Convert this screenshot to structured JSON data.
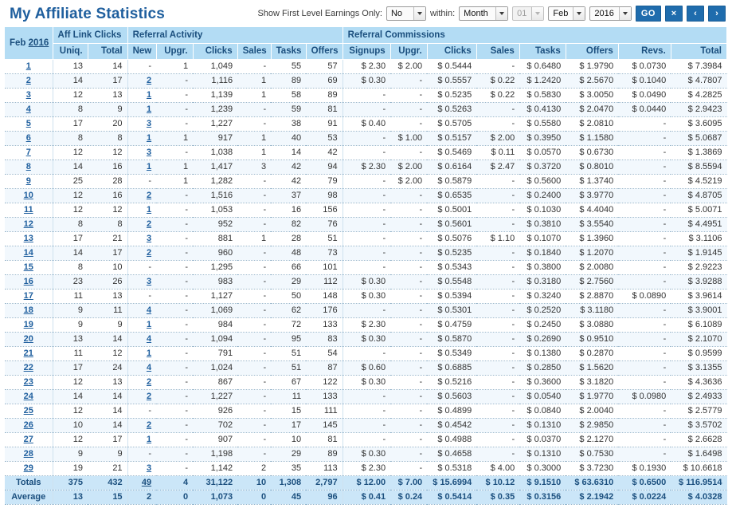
{
  "header": {
    "title": "My Affiliate Statistics",
    "controls": {
      "first_level_label": "Show First Level Earnings Only:",
      "first_level_value": "No",
      "within_label": "within:",
      "within_value": "Month",
      "day_value": "01",
      "month_value": "Feb",
      "year_value": "2016",
      "go_label": "GO",
      "clear_label": "×",
      "prev_label": "‹",
      "next_label": "›"
    }
  },
  "table": {
    "date_label_month": "Feb",
    "date_label_year": "2016",
    "groups": [
      {
        "label": "Aff Link Clicks",
        "span": 2
      },
      {
        "label": "Referral Activity",
        "span": 6
      },
      {
        "label": "Referral Commissions",
        "span": 8
      }
    ],
    "columns": [
      "Uniq.",
      "Total",
      "New",
      "Upgr.",
      "Clicks",
      "Sales",
      "Tasks",
      "Offers",
      "Signups",
      "Upgr.",
      "Clicks",
      "Sales",
      "Tasks",
      "Offers",
      "Revs.",
      "Total"
    ],
    "totals_label": "Totals",
    "average_label": "Average",
    "rows": [
      {
        "day": "1",
        "cells": [
          "13",
          "14",
          "-",
          "1",
          "1,049",
          "-",
          "55",
          "57",
          "$ 2.30",
          "$ 2.00",
          "$ 0.5444",
          "-",
          "$ 0.6480",
          "$ 1.9790",
          "$ 0.0730",
          "$ 7.3984"
        ],
        "links": []
      },
      {
        "day": "2",
        "cells": [
          "14",
          "17",
          "2",
          "-",
          "1,116",
          "1",
          "89",
          "69",
          "$ 0.30",
          "-",
          "$ 0.5557",
          "$ 0.22",
          "$ 1.2420",
          "$ 2.5670",
          "$ 0.1040",
          "$ 4.7807"
        ],
        "links": [
          2
        ]
      },
      {
        "day": "3",
        "cells": [
          "12",
          "13",
          "1",
          "-",
          "1,139",
          "1",
          "58",
          "89",
          "-",
          "-",
          "$ 0.5235",
          "$ 0.22",
          "$ 0.5830",
          "$ 3.0050",
          "$ 0.0490",
          "$ 4.2825"
        ],
        "links": [
          2
        ]
      },
      {
        "day": "4",
        "cells": [
          "8",
          "9",
          "1",
          "-",
          "1,239",
          "-",
          "59",
          "81",
          "-",
          "-",
          "$ 0.5263",
          "-",
          "$ 0.4130",
          "$ 2.0470",
          "$ 0.0440",
          "$ 2.9423"
        ],
        "links": [
          2
        ]
      },
      {
        "day": "5",
        "cells": [
          "17",
          "20",
          "3",
          "-",
          "1,227",
          "-",
          "38",
          "91",
          "$ 0.40",
          "-",
          "$ 0.5705",
          "-",
          "$ 0.5580",
          "$ 2.0810",
          "-",
          "$ 3.6095"
        ],
        "links": [
          2
        ]
      },
      {
        "day": "6",
        "cells": [
          "8",
          "8",
          "1",
          "1",
          "917",
          "1",
          "40",
          "53",
          "-",
          "$ 1.00",
          "$ 0.5157",
          "$ 2.00",
          "$ 0.3950",
          "$ 1.1580",
          "-",
          "$ 5.0687"
        ],
        "links": [
          2
        ]
      },
      {
        "day": "7",
        "cells": [
          "12",
          "12",
          "3",
          "-",
          "1,038",
          "1",
          "14",
          "42",
          "-",
          "-",
          "$ 0.5469",
          "$ 0.11",
          "$ 0.0570",
          "$ 0.6730",
          "-",
          "$ 1.3869"
        ],
        "links": [
          2
        ]
      },
      {
        "day": "8",
        "cells": [
          "14",
          "16",
          "1",
          "1",
          "1,417",
          "3",
          "42",
          "94",
          "$ 2.30",
          "$ 2.00",
          "$ 0.6164",
          "$ 2.47",
          "$ 0.3720",
          "$ 0.8010",
          "-",
          "$ 8.5594"
        ],
        "links": [
          2
        ]
      },
      {
        "day": "9",
        "cells": [
          "25",
          "28",
          "-",
          "1",
          "1,282",
          "-",
          "42",
          "79",
          "-",
          "$ 2.00",
          "$ 0.5879",
          "-",
          "$ 0.5600",
          "$ 1.3740",
          "-",
          "$ 4.5219"
        ],
        "links": []
      },
      {
        "day": "10",
        "cells": [
          "12",
          "16",
          "2",
          "-",
          "1,516",
          "-",
          "37",
          "98",
          "-",
          "-",
          "$ 0.6535",
          "-",
          "$ 0.2400",
          "$ 3.9770",
          "-",
          "$ 4.8705"
        ],
        "links": [
          2
        ]
      },
      {
        "day": "11",
        "cells": [
          "12",
          "12",
          "1",
          "-",
          "1,053",
          "-",
          "16",
          "156",
          "-",
          "-",
          "$ 0.5001",
          "-",
          "$ 0.1030",
          "$ 4.4040",
          "-",
          "$ 5.0071"
        ],
        "links": [
          2
        ]
      },
      {
        "day": "12",
        "cells": [
          "8",
          "8",
          "2",
          "-",
          "952",
          "-",
          "82",
          "76",
          "-",
          "-",
          "$ 0.5601",
          "-",
          "$ 0.3810",
          "$ 3.5540",
          "-",
          "$ 4.4951"
        ],
        "links": [
          2
        ]
      },
      {
        "day": "13",
        "cells": [
          "17",
          "21",
          "3",
          "-",
          "881",
          "1",
          "28",
          "51",
          "-",
          "-",
          "$ 0.5076",
          "$ 1.10",
          "$ 0.1070",
          "$ 1.3960",
          "-",
          "$ 3.1106"
        ],
        "links": [
          2
        ]
      },
      {
        "day": "14",
        "cells": [
          "14",
          "17",
          "2",
          "-",
          "960",
          "-",
          "48",
          "73",
          "-",
          "-",
          "$ 0.5235",
          "-",
          "$ 0.1840",
          "$ 1.2070",
          "-",
          "$ 1.9145"
        ],
        "links": [
          2
        ]
      },
      {
        "day": "15",
        "cells": [
          "8",
          "10",
          "-",
          "-",
          "1,295",
          "-",
          "66",
          "101",
          "-",
          "-",
          "$ 0.5343",
          "-",
          "$ 0.3800",
          "$ 2.0080",
          "-",
          "$ 2.9223"
        ],
        "links": []
      },
      {
        "day": "16",
        "cells": [
          "23",
          "26",
          "3",
          "-",
          "983",
          "-",
          "29",
          "112",
          "$ 0.30",
          "-",
          "$ 0.5548",
          "-",
          "$ 0.3180",
          "$ 2.7560",
          "-",
          "$ 3.9288"
        ],
        "links": [
          2
        ]
      },
      {
        "day": "17",
        "cells": [
          "11",
          "13",
          "-",
          "-",
          "1,127",
          "-",
          "50",
          "148",
          "$ 0.30",
          "-",
          "$ 0.5394",
          "-",
          "$ 0.3240",
          "$ 2.8870",
          "$ 0.0890",
          "$ 3.9614"
        ],
        "links": []
      },
      {
        "day": "18",
        "cells": [
          "9",
          "11",
          "4",
          "-",
          "1,069",
          "-",
          "62",
          "176",
          "-",
          "-",
          "$ 0.5301",
          "-",
          "$ 0.2520",
          "$ 3.1180",
          "-",
          "$ 3.9001"
        ],
        "links": [
          2
        ]
      },
      {
        "day": "19",
        "cells": [
          "9",
          "9",
          "1",
          "-",
          "984",
          "-",
          "72",
          "133",
          "$ 2.30",
          "-",
          "$ 0.4759",
          "-",
          "$ 0.2450",
          "$ 3.0880",
          "-",
          "$ 6.1089"
        ],
        "links": [
          2
        ]
      },
      {
        "day": "20",
        "cells": [
          "13",
          "14",
          "4",
          "-",
          "1,094",
          "-",
          "95",
          "83",
          "$ 0.30",
          "-",
          "$ 0.5870",
          "-",
          "$ 0.2690",
          "$ 0.9510",
          "-",
          "$ 2.1070"
        ],
        "links": [
          2
        ]
      },
      {
        "day": "21",
        "cells": [
          "11",
          "12",
          "1",
          "-",
          "791",
          "-",
          "51",
          "54",
          "-",
          "-",
          "$ 0.5349",
          "-",
          "$ 0.1380",
          "$ 0.2870",
          "-",
          "$ 0.9599"
        ],
        "links": [
          2
        ]
      },
      {
        "day": "22",
        "cells": [
          "17",
          "24",
          "4",
          "-",
          "1,024",
          "-",
          "51",
          "87",
          "$ 0.60",
          "-",
          "$ 0.6885",
          "-",
          "$ 0.2850",
          "$ 1.5620",
          "-",
          "$ 3.1355"
        ],
        "links": [
          2
        ]
      },
      {
        "day": "23",
        "cells": [
          "12",
          "13",
          "2",
          "-",
          "867",
          "-",
          "67",
          "122",
          "$ 0.30",
          "-",
          "$ 0.5216",
          "-",
          "$ 0.3600",
          "$ 3.1820",
          "-",
          "$ 4.3636"
        ],
        "links": [
          2
        ]
      },
      {
        "day": "24",
        "cells": [
          "14",
          "14",
          "2",
          "-",
          "1,227",
          "-",
          "11",
          "133",
          "-",
          "-",
          "$ 0.5603",
          "-",
          "$ 0.0540",
          "$ 1.9770",
          "$ 0.0980",
          "$ 2.4933"
        ],
        "links": [
          2
        ]
      },
      {
        "day": "25",
        "cells": [
          "12",
          "14",
          "-",
          "-",
          "926",
          "-",
          "15",
          "111",
          "-",
          "-",
          "$ 0.4899",
          "-",
          "$ 0.0840",
          "$ 2.0040",
          "-",
          "$ 2.5779"
        ],
        "links": []
      },
      {
        "day": "26",
        "cells": [
          "10",
          "14",
          "2",
          "-",
          "702",
          "-",
          "17",
          "145",
          "-",
          "-",
          "$ 0.4542",
          "-",
          "$ 0.1310",
          "$ 2.9850",
          "-",
          "$ 3.5702"
        ],
        "links": [
          2
        ]
      },
      {
        "day": "27",
        "cells": [
          "12",
          "17",
          "1",
          "-",
          "907",
          "-",
          "10",
          "81",
          "-",
          "-",
          "$ 0.4988",
          "-",
          "$ 0.0370",
          "$ 2.1270",
          "-",
          "$ 2.6628"
        ],
        "links": [
          2
        ]
      },
      {
        "day": "28",
        "cells": [
          "9",
          "9",
          "-",
          "-",
          "1,198",
          "-",
          "29",
          "89",
          "$ 0.30",
          "-",
          "$ 0.4658",
          "-",
          "$ 0.1310",
          "$ 0.7530",
          "-",
          "$ 1.6498"
        ],
        "links": []
      },
      {
        "day": "29",
        "cells": [
          "19",
          "21",
          "3",
          "-",
          "1,142",
          "2",
          "35",
          "113",
          "$ 2.30",
          "-",
          "$ 0.5318",
          "$ 4.00",
          "$ 0.3000",
          "$ 3.7230",
          "$ 0.1930",
          "$ 10.6618"
        ],
        "links": [
          2
        ]
      }
    ],
    "totals": {
      "label": "Totals",
      "cells": [
        "375",
        "432",
        "49",
        "4",
        "31,122",
        "10",
        "1,308",
        "2,797",
        "$ 12.00",
        "$ 7.00",
        "$ 15.6994",
        "$ 10.12",
        "$ 9.1510",
        "$ 63.6310",
        "$ 0.6500",
        "$ 116.9514"
      ],
      "links": [
        2
      ]
    },
    "average": {
      "label": "Average",
      "cells": [
        "13",
        "15",
        "2",
        "0",
        "1,073",
        "0",
        "45",
        "96",
        "$ 0.41",
        "$ 0.24",
        "$ 0.5414",
        "$ 0.35",
        "$ 0.3156",
        "$ 2.1942",
        "$ 0.0224",
        "$ 4.0328"
      ],
      "links": []
    }
  },
  "colors": {
    "title": "#1f5f9e",
    "header_bg": "#b3dcf4",
    "totals_bg": "#cbe6f8",
    "alt_row_bg": "#f2f8fd",
    "button_bg": "#1f6cad"
  }
}
